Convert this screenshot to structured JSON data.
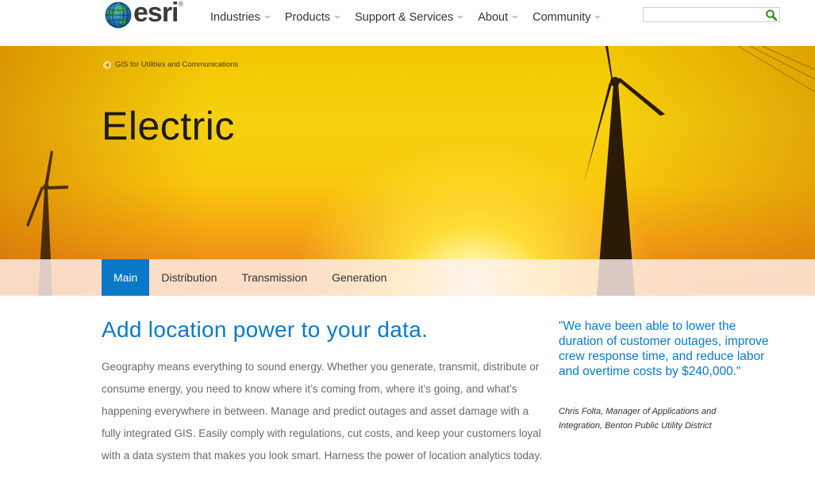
{
  "brand": {
    "name": "esri",
    "registered": "®"
  },
  "nav": {
    "items": [
      {
        "label": "Industries"
      },
      {
        "label": "Products"
      },
      {
        "label": "Support & Services"
      },
      {
        "label": "About"
      },
      {
        "label": "Community"
      }
    ]
  },
  "search": {
    "value": "",
    "placeholder": ""
  },
  "hero": {
    "breadcrumb": "GIS for Utilities and Communications",
    "title": "Electric"
  },
  "tabs": [
    {
      "label": "Main",
      "active": true
    },
    {
      "label": "Distribution",
      "active": false
    },
    {
      "label": "Transmission",
      "active": false
    },
    {
      "label": "Generation",
      "active": false
    }
  ],
  "main": {
    "heading": "Add location power to your data.",
    "body": "Geography means everything to sound energy. Whether you generate, transmit, distribute or consume energy, you need to know where it’s coming from, where it’s going, and what’s happening everywhere in between. Manage and predict outages and asset damage with a fully integrated GIS. Easily comply with regulations, cut costs, and keep your customers loyal with a data system that makes you look smart. Harness the power of location analytics today."
  },
  "quote": {
    "text": "\"We have been able to lower the duration of customer outages, improve crew response time, and reduce labor and overtime costs by $240,000.\"",
    "author": "Chris Folta, Manager of Applications and Integration, Benton Public Utility District"
  },
  "colors": {
    "accent": "#0a78c8",
    "tab_active_bg": "#0a78c8",
    "hero_yellow": "#f6d20e"
  },
  "icons": {
    "logo": "globe-icon",
    "search": "search-icon",
    "breadcrumb": "chevron-left-icon",
    "nav_caret": "caret-down-icon"
  }
}
